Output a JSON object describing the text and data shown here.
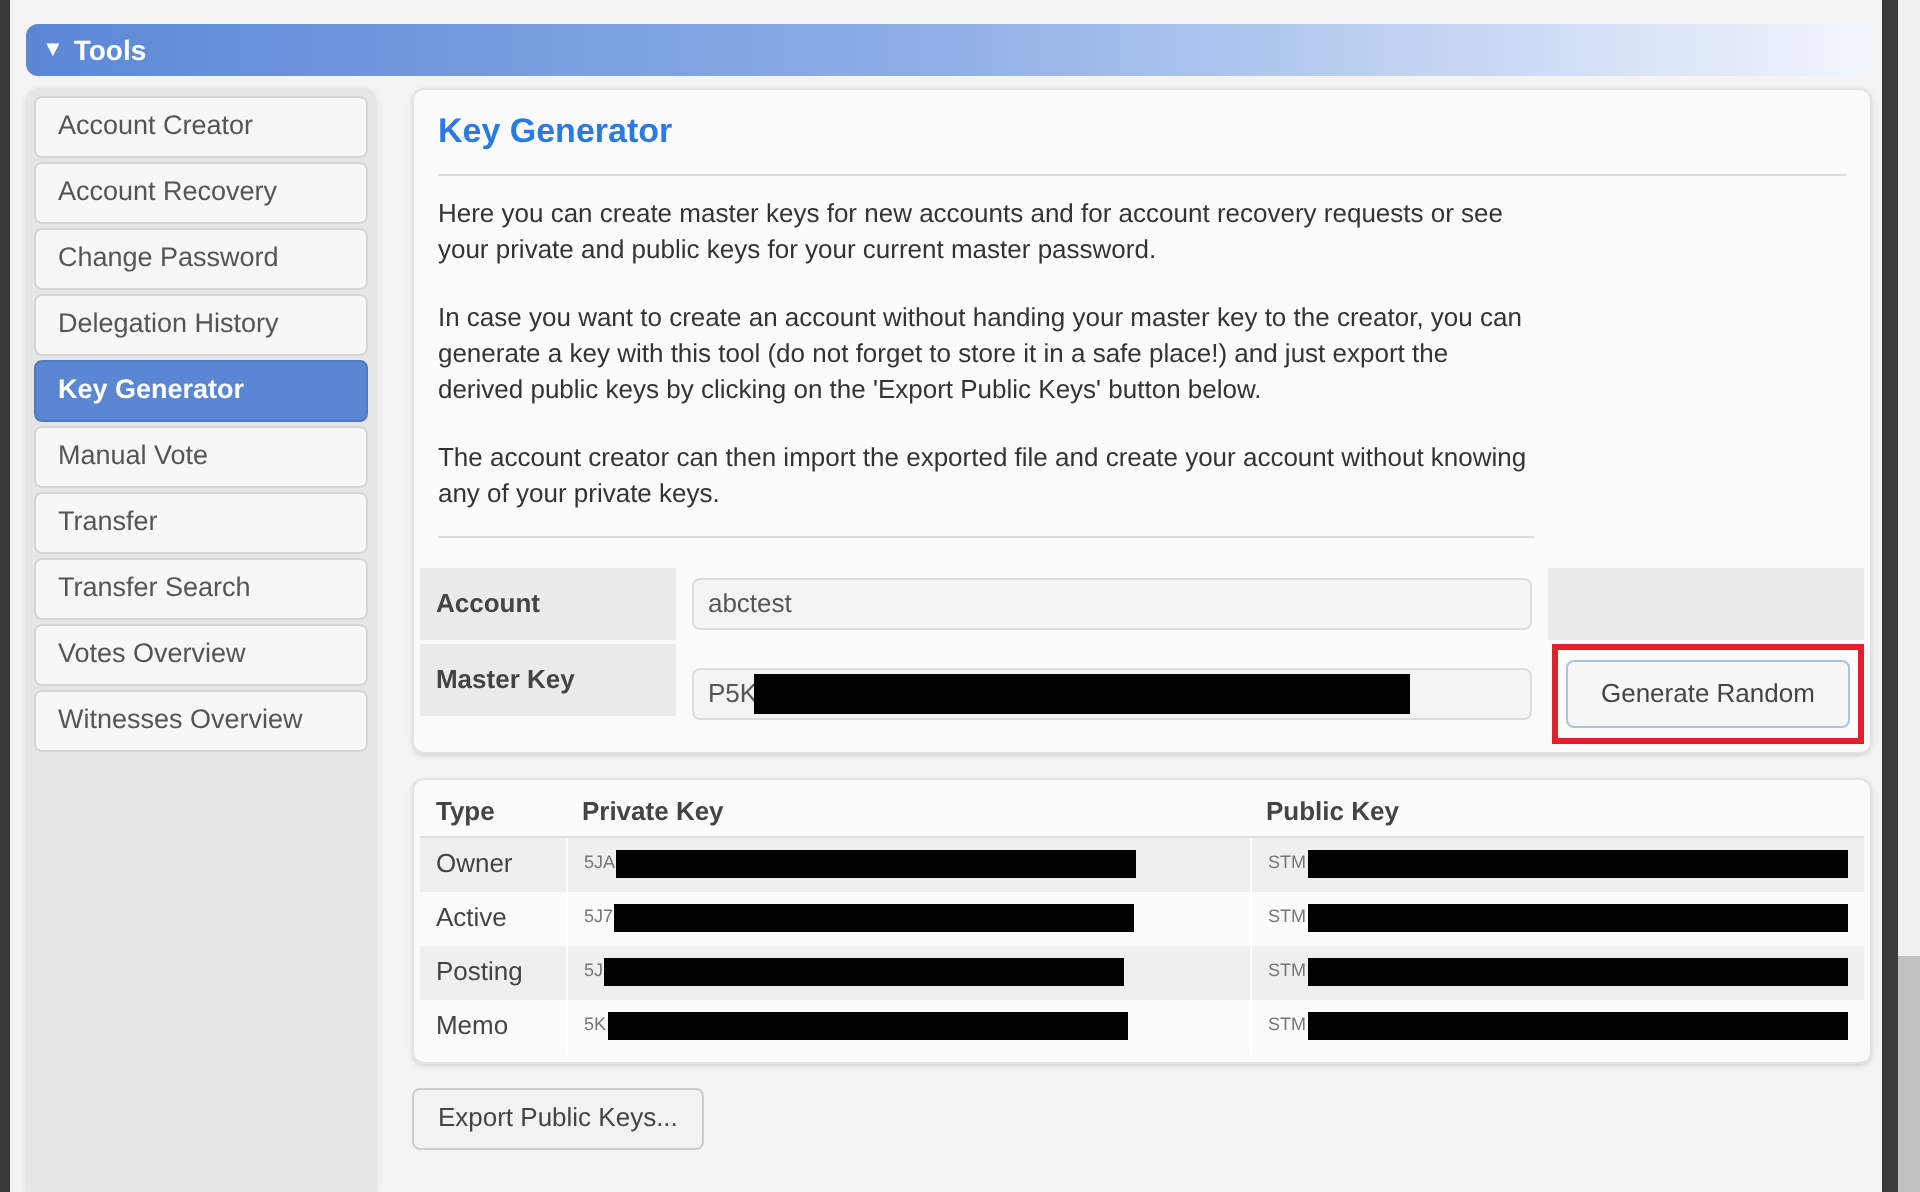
{
  "header": {
    "icon": "▼",
    "title": "Tools"
  },
  "sidebar": {
    "items": [
      {
        "label": "Account Creator",
        "selected": false
      },
      {
        "label": "Account Recovery",
        "selected": false
      },
      {
        "label": "Change Password",
        "selected": false
      },
      {
        "label": "Delegation History",
        "selected": false
      },
      {
        "label": "Key Generator",
        "selected": true
      },
      {
        "label": "Manual Vote",
        "selected": false
      },
      {
        "label": "Transfer",
        "selected": false
      },
      {
        "label": "Transfer Search",
        "selected": false
      },
      {
        "label": "Votes Overview",
        "selected": false
      },
      {
        "label": "Witnesses Overview",
        "selected": false
      }
    ]
  },
  "panel": {
    "title": "Key Generator",
    "paragraphs": [
      "Here you can create master keys for new accounts and for account recovery requests or see your private and public keys for your current master password.",
      "In case you want to create an account without handing your master key to the creator, you can generate a key with this tool (do not forget to store it in a safe place!) and just export the derived public keys by clicking on the 'Export Public Keys' button below.",
      "The account creator can then import the exported file and create your account without knowing any of your private keys."
    ],
    "account": {
      "label": "Account",
      "value": "abctest"
    },
    "master_key": {
      "label": "Master Key",
      "value": "P5K",
      "redacted": true
    },
    "generate_button": {
      "label": "Generate Random",
      "highlighted": true
    }
  },
  "keys": {
    "columns": [
      "Type",
      "Private Key",
      "Public Key"
    ],
    "rows": [
      {
        "type": "Owner",
        "private": "5JA",
        "public": "STM"
      },
      {
        "type": "Active",
        "private": "5J7",
        "public": "STM"
      },
      {
        "type": "Posting",
        "private": "5J",
        "public": "STM"
      },
      {
        "type": "Memo",
        "private": "5K",
        "public": "STM"
      }
    ]
  },
  "export_button": {
    "label": "Export Public Keys..."
  }
}
